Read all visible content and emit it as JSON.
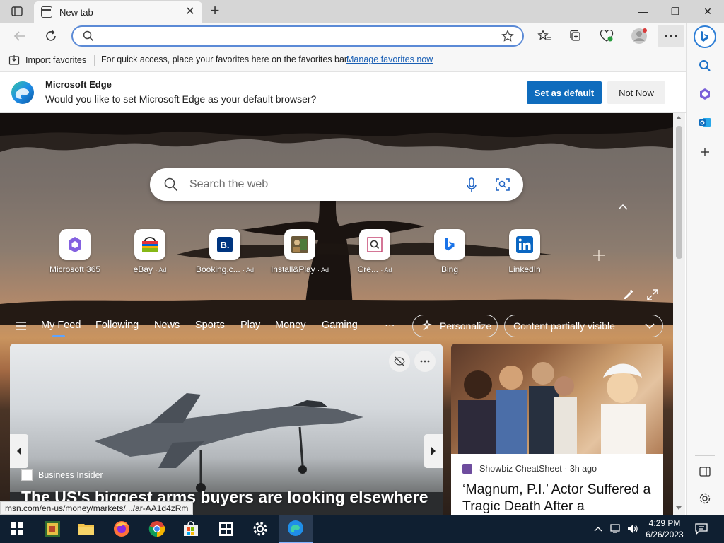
{
  "tab": {
    "title": "New tab",
    "close": "✕",
    "new": "+"
  },
  "window": {
    "minimize": "—",
    "restore": "❐",
    "close": "✕"
  },
  "address": {
    "value": "",
    "placeholder": ""
  },
  "favorites_bar": {
    "import_label": "Import favorites",
    "message": "For quick access, place your favorites here on the favorites bar.",
    "link": "Manage favorites now"
  },
  "infobar": {
    "title": "Microsoft Edge",
    "message": "Would you like to set Microsoft Edge as your default browser?",
    "primary": "Set as default",
    "secondary": "Not Now"
  },
  "search": {
    "placeholder": "Search the web"
  },
  "quick_links": [
    {
      "label": "Microsoft 365",
      "ad": "",
      "icon": "microsoft-365-icon"
    },
    {
      "label": "eBay",
      "ad": "· Ad",
      "icon": "ebay-icon"
    },
    {
      "label": "Booking.c...",
      "ad": "· Ad",
      "icon": "booking-icon"
    },
    {
      "label": "Install&Play",
      "ad": "· Ad",
      "icon": "install-play-icon"
    },
    {
      "label": "Cre...",
      "ad": "· Ad",
      "icon": "search-square-icon"
    },
    {
      "label": "Bing",
      "ad": "",
      "icon": "bing-icon"
    },
    {
      "label": "LinkedIn",
      "ad": "",
      "icon": "linkedin-icon"
    }
  ],
  "feed_nav": {
    "items": [
      "My Feed",
      "Following",
      "News",
      "Sports",
      "Play",
      "Money",
      "Gaming",
      "···"
    ],
    "personalize": "Personalize",
    "content_visibility": "Content partially visible"
  },
  "cards": [
    {
      "source": "Business Insider",
      "headline": "The US's biggest arms buyers are looking elsewhere"
    },
    {
      "source": "Showbiz CheatSheet · 3h ago",
      "headline": "‘Magnum, P.I.’ Actor Suffered a Tragic Death After a"
    }
  ],
  "status_url": "msn.com/en-us/money/markets/.../ar-AA1d4zRm",
  "clock": {
    "time": "4:29 PM",
    "date": "6/26/2023"
  },
  "colors": {
    "accent": "#0f6cbd",
    "taskbar": "#0f1f31",
    "link": "#1a5fb4"
  }
}
